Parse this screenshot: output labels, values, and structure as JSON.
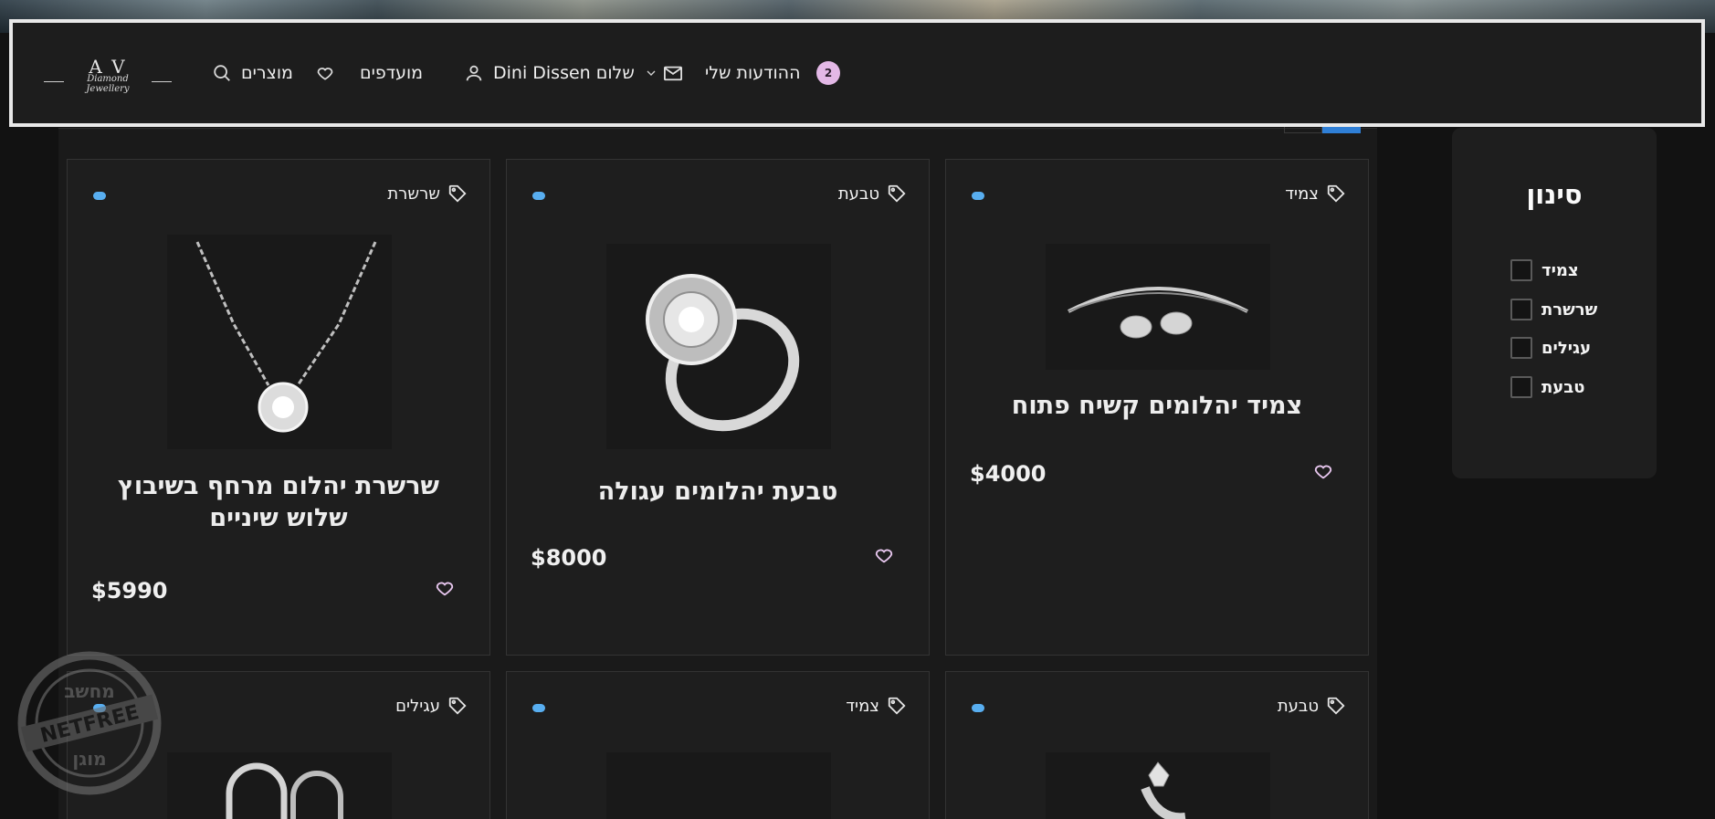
{
  "header": {
    "logo_monogram": "A V",
    "logo_script": "Diamond Jewellery",
    "products_label": "מוצרים",
    "favorites_label": "מועדפים",
    "user_greeting": "Dini Dissen שלום",
    "messages_label": "ההודעות שלי",
    "messages_count": "2"
  },
  "filter": {
    "title": "סינון",
    "options": [
      "צמיד",
      "שרשרת",
      "עגילים",
      "טבעת"
    ]
  },
  "products": [
    {
      "category": "צמיד",
      "title": "צמיד יהלומים קשיח פתוח",
      "price": "$4000"
    },
    {
      "category": "טבעת",
      "title": "טבעת יהלומים עגולה",
      "price": "$8000"
    },
    {
      "category": "שרשרת",
      "title": "שרשרת יהלום מרחף בשיבוץ שלוש שיניים",
      "price": "$5990"
    },
    {
      "category": "טבעת",
      "title": "",
      "price": ""
    },
    {
      "category": "צמיד",
      "title": "",
      "price": ""
    },
    {
      "category": "עגילים",
      "title": "",
      "price": ""
    }
  ],
  "watermark": {
    "top": "מחשב",
    "middle": "NETFREE",
    "bottom": "מוגן"
  },
  "colors": {
    "accent": "#58aef0",
    "badge": "#e3b8e6",
    "heart": "#e7c6ee",
    "grid_toggle": "#2f7fd6"
  }
}
